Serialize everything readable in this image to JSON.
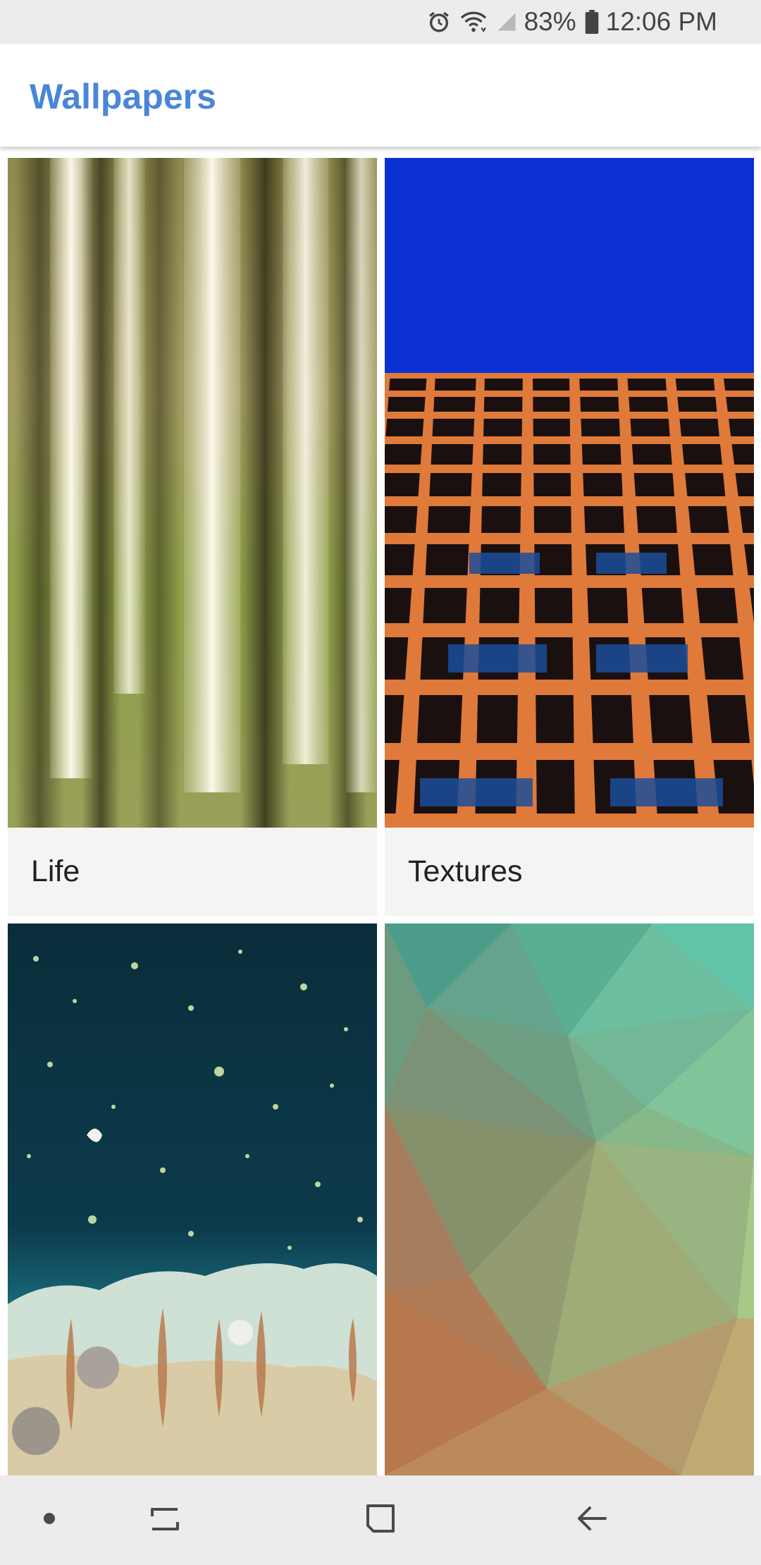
{
  "status_bar": {
    "battery": "83%",
    "time": "12:06 PM",
    "icons": [
      "alarm-icon",
      "wifi-icon",
      "signal-icon",
      "battery-icon"
    ]
  },
  "app_bar": {
    "title": "Wallpapers",
    "accent_color": "#4a86d8"
  },
  "categories": [
    {
      "label": "Life",
      "thumbnail": "blurred-birch-trees"
    },
    {
      "label": "Textures",
      "thumbnail": "orange-building-facade-blue-sky"
    },
    {
      "label": "",
      "thumbnail": "aerial-teal-water-shore"
    },
    {
      "label": "",
      "thumbnail": "green-polygon-gradient"
    }
  ],
  "nav_bar": {
    "buttons": [
      "dot-button",
      "recents-button",
      "home-button",
      "back-button"
    ]
  }
}
